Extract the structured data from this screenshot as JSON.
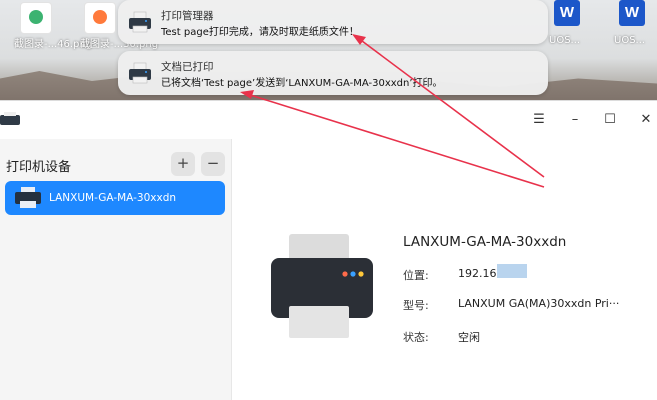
{
  "desktop": {
    "icons": [
      {
        "label": "截图录-...46.png"
      },
      {
        "label": "截图录-...30.png"
      },
      {
        "label": ""
      },
      {
        "label": ""
      },
      {
        "label": "UOS..."
      },
      {
        "label": "UOS..."
      }
    ],
    "word_icon_label": "W"
  },
  "notifications": [
    {
      "title": "打印管理器",
      "body": "Test page打印完成，请及时取走纸质文件！"
    },
    {
      "title": "文档已打印",
      "body": "已将文档‘Test page’发送到‘LANXUM-GA-MA-30xxdn’打印。"
    }
  ],
  "window": {
    "controls": {
      "menu": "☰",
      "minimize": "–",
      "maximize": "☐",
      "close": "✕"
    }
  },
  "sidebar": {
    "title": "打印机设备",
    "add_label": "+",
    "remove_label": "−",
    "devices": [
      {
        "name": "LANXUM-GA-MA-30xxdn"
      }
    ]
  },
  "detail": {
    "name": "LANXUM-GA-MA-30xxdn",
    "location_label": "位置:",
    "location_value": "192.168",
    "model_label": "型号:",
    "model_value": "LANXUM  GA(MA)30xxdn  Pri···",
    "status_label": "状态:",
    "status_value": "空闲"
  },
  "colors": {
    "accent": "#1e88ff",
    "arrow": "#e8324b"
  }
}
